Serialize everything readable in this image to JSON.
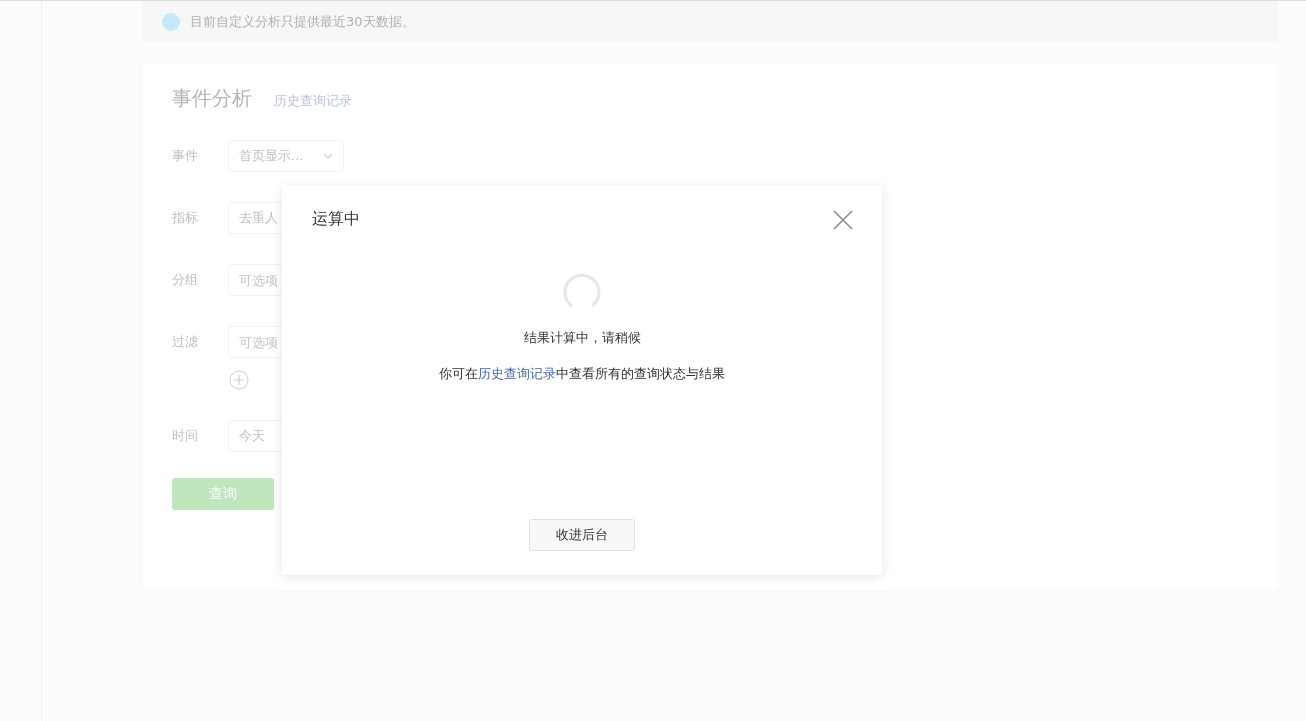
{
  "notice": {
    "text": "目前自定义分析只提供最近30天数据。"
  },
  "card": {
    "title": "事件分析",
    "history_link": "历史查询记录",
    "rows": [
      {
        "label": "事件",
        "kind": "select",
        "value": "首页显示..."
      },
      {
        "label": "指标",
        "kind": "input",
        "value": "去重人"
      },
      {
        "label": "分组",
        "kind": "input",
        "placeholder": "可选项"
      },
      {
        "label": "过滤",
        "kind": "filter",
        "placeholder": "可选项"
      },
      {
        "label": "时间",
        "kind": "input",
        "value": "今天"
      }
    ],
    "query_button": "查询"
  },
  "modal": {
    "title": "运算中",
    "message": "结果计算中，请稍候",
    "hint_before": "你可在",
    "hint_link": "历史查询记录",
    "hint_after": "中查看所有的查询状态与结果",
    "button": "收进后台"
  }
}
